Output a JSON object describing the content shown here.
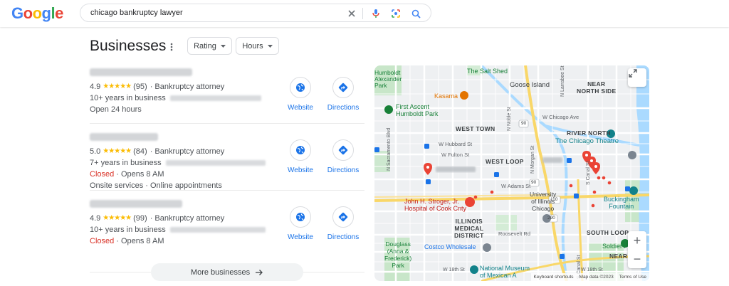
{
  "header": {
    "logo": [
      "G",
      "o",
      "o",
      "g",
      "l",
      "e"
    ],
    "query": "chicago bankruptcy lawyer"
  },
  "section": {
    "title": "Businesses",
    "filters": [
      "Rating",
      "Hours"
    ]
  },
  "listings": [
    {
      "rating": "4.9",
      "stars": "★★★★★",
      "reviews": "(95)",
      "category": "· Bankruptcy attorney",
      "line2": "10+ years in business",
      "line3": "Open 24 hours",
      "website": "Website",
      "directions": "Directions"
    },
    {
      "rating": "5.0",
      "stars": "★★★★★",
      "reviews": "(84)",
      "category": "· Bankruptcy attorney",
      "line2": "7+ years in business",
      "closed": "Closed",
      "opens": "· Opens 8 AM",
      "line4": "Onsite services · Online appointments",
      "website": "Website",
      "directions": "Directions"
    },
    {
      "rating": "4.9",
      "stars": "★★★★★",
      "reviews": "(99)",
      "category": "· Bankruptcy attorney",
      "line2": "10+ years in business",
      "closed": "Closed",
      "opens": "· Opens 8 AM",
      "website": "Website",
      "directions": "Directions"
    }
  ],
  "more_button": "More businesses",
  "map": {
    "labels": {
      "humboldt": "Humboldt\nAlexander\nPark",
      "salt_shed": "The Salt Shed",
      "goose_island": "Goose Island",
      "near_north": "NEAR\nNORTH SIDE",
      "kasama": "Kasama",
      "first_ascent": "First Ascent\nHumboldt Park",
      "west_town": "WEST TOWN",
      "chicago_ave": "W Chicago Ave",
      "river_north": "RIVER NORTH",
      "chicago_theatre": "The Chicago Theatre",
      "hubbard": "W Hubbard St",
      "fulton": "W Fulton St",
      "west_loop": "WEST LOOP",
      "adams": "W Adams St",
      "uic": "University\nof Illinois\nChicago",
      "stroger": "John H. Stroger, Jr.\nHospital of Cook Cnty",
      "buckingham": "Buckingham\nFountain",
      "illinois_medical": "ILLINOIS\nMEDICAL\nDISTRICT",
      "roosevelt": "Roosevelt Rd",
      "south_loop": "SOUTH LOOP",
      "douglass": "Douglass\n(Anna &\nFrederick)\nPark",
      "costco": "Costco Wholesale",
      "soldier_field": "Soldier Fie",
      "near_south": "NEAR",
      "w18": "W 18th St",
      "w18b": "W 18th St",
      "national_museum": "National Museum\nof Mexican A",
      "canal": "S Canal St",
      "morgan": "N Morgan St",
      "sacramento": "N Sacramento Blvd",
      "noble": "N Noble St",
      "larrabee": "N Larrabee St",
      "s_canal": "S Canal St",
      "route90": "90",
      "route290": "290",
      "route110": "110"
    },
    "attribution": [
      "Keyboard shortcuts",
      "Map data ©2023",
      "Terms of Use"
    ]
  },
  "colors": {
    "link": "#1a73e8",
    "closed": "#d93025",
    "star": "#fbbc04",
    "pin": "#ea4335",
    "park": "#c8e6c9"
  }
}
